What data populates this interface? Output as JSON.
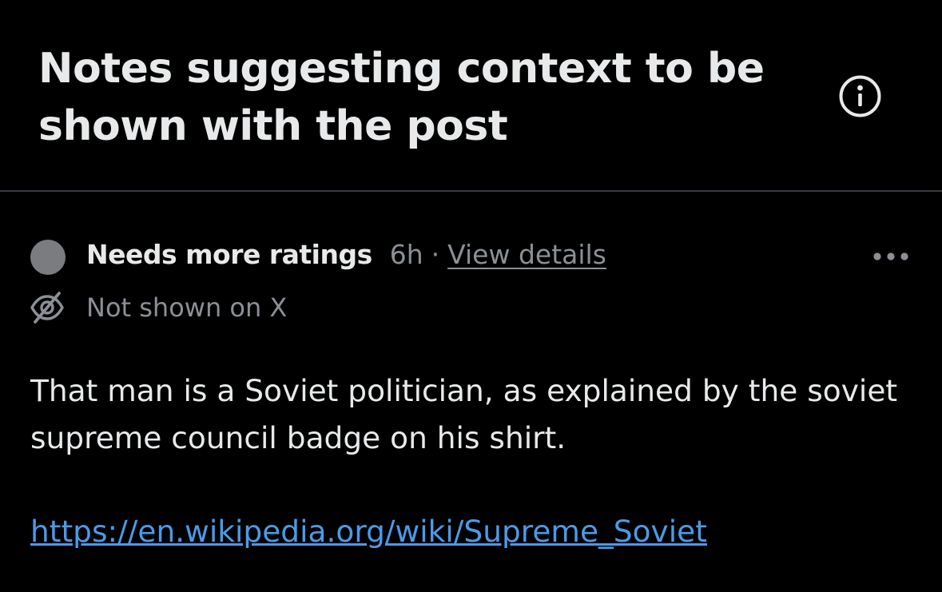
{
  "header": {
    "title": "Notes suggesting context to be shown with the post",
    "info_icon": "info-circle-icon"
  },
  "note": {
    "status_label": "Needs more ratings",
    "time_ago": "6h",
    "separator": "·",
    "view_details_label": "View details",
    "more_icon": "more-horizontal-icon",
    "hidden_icon": "eye-slash-icon",
    "hidden_label": "Not shown on X",
    "body": "That man is a Soviet politician, as explained by the soviet supreme council badge on his shirt.",
    "link": "https://en.wikipedia.org/wiki/Supreme_Soviet"
  },
  "colors": {
    "background": "#000000",
    "primary_text": "#e7e9ea",
    "secondary_text": "#8b9096",
    "link": "#4a9be8",
    "status_dot": "#7a7c80",
    "divider": "#3a3d41"
  }
}
